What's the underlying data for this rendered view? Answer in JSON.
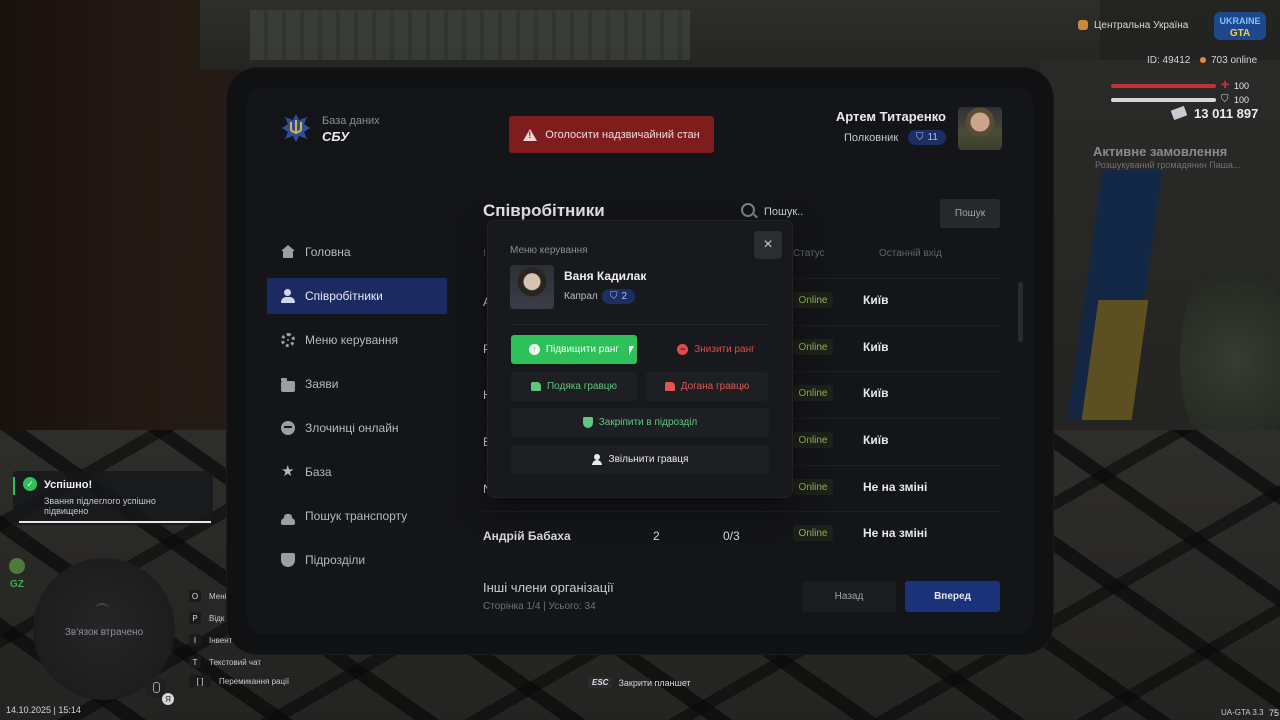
{
  "brand": {
    "subtitle": "База даних",
    "title": "СБУ"
  },
  "alert_button": "Оголосити надзвичайний стан",
  "user": {
    "name": "Артем Титаренко",
    "rank": "Полковник",
    "rank_level": "11"
  },
  "sidebar": {
    "items": [
      {
        "label": "Головна",
        "icon": "home-icon"
      },
      {
        "label": "Співробітники",
        "icon": "people-icon",
        "active": true
      },
      {
        "label": "Меню керування",
        "icon": "gear-icon"
      },
      {
        "label": "Заяви",
        "icon": "folder-icon"
      },
      {
        "label": "Злочинці онлайн",
        "icon": "mask-icon"
      },
      {
        "label": "База",
        "icon": "star-icon"
      },
      {
        "label": "Пошук транспорту",
        "icon": "car-icon"
      },
      {
        "label": "Підрозділи",
        "icon": "shield-icon"
      }
    ]
  },
  "employees": {
    "title": "Співробітники",
    "search_placeholder": "Пошук..",
    "search_button": "Пошук",
    "columns": {
      "status": "Статус",
      "last_login": "Останній вхід"
    },
    "rows": [
      {
        "name": "А",
        "status": "Online",
        "last_login": "Київ"
      },
      {
        "name": "Р",
        "status": "Online",
        "last_login": "Київ"
      },
      {
        "name": "Н",
        "status": "Online",
        "last_login": "Київ"
      },
      {
        "name": "Е",
        "status": "Online",
        "last_login": "Київ"
      },
      {
        "name": "N",
        "status": "Online",
        "last_login": "Не на зміні"
      },
      {
        "name": "Андрій Бабаха",
        "rank": "2",
        "warnings": "0/3",
        "status": "Online",
        "last_login": "Не на зміні"
      }
    ],
    "other_title": "Інші члени організації",
    "pagination": "Сторінка 1/4 | Усього: 34",
    "back_button": "Назад",
    "next_button": "Вперед"
  },
  "modal": {
    "label": "Меню керування",
    "close": "×",
    "name": "Ваня Кадилак",
    "rank": "Капрал",
    "rank_level": "2",
    "buttons": {
      "promote": "Підвищити ранг",
      "demote": "Знизити ранг",
      "thank": "Подяка гравцю",
      "rebuke": "Догана гравцю",
      "assign": "Закріпити в підрозділ",
      "dismiss": "Звільнити гравця"
    }
  },
  "hud": {
    "region": "Центральна Україна",
    "id": "ID: 49412",
    "online": "703 online",
    "hp": "100",
    "armor": "100",
    "money": "13 011 897",
    "order_title": "Активне замовлення",
    "order_sub": "Розшукуваний громадянин Паша..."
  },
  "toast": {
    "title": "Успішно!",
    "text": "Звання підлеглого успішно підвищено"
  },
  "zone": "GZ",
  "map_text": "Зв'язок втрачено",
  "keys": [
    {
      "key": "O",
      "label": "Мені"
    },
    {
      "key": "P",
      "label": "Відк"
    },
    {
      "key": "I",
      "label": "Інвент"
    },
    {
      "key": "T",
      "label": "Текстовий чат"
    },
    {
      "key": "[ ]",
      "label": "Перемикання рації"
    }
  ],
  "datetime": "14.10.2025 | 15:14",
  "esc": {
    "key": "ESC",
    "label": "Закрити планшет"
  },
  "version": "UA-GTA 3.3",
  "fps": "75",
  "mic_badge": "Я",
  "logo_text": "UKRAINE GTA"
}
